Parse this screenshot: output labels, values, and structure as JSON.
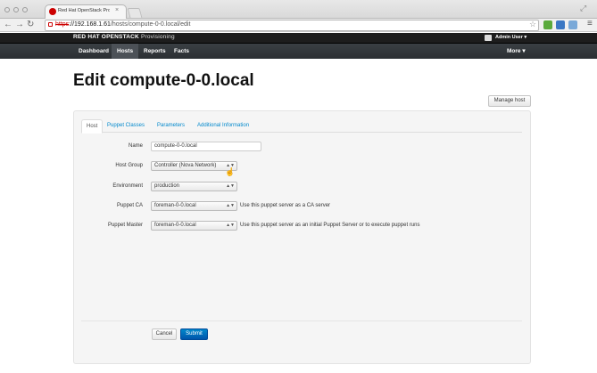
{
  "browser": {
    "tab_title": "Red Hat OpenStack Provis",
    "url_scheme": "https",
    "url_host": "://192.168.1.61",
    "url_path": "/hosts/compute-0-0.local/edit"
  },
  "header": {
    "brand": "RED HAT OPENSTACK",
    "brand_sub": "Provisioning",
    "user": "Admin User ▾"
  },
  "nav": {
    "items": [
      "Dashboard",
      "Hosts",
      "Reports",
      "Facts"
    ],
    "active": "Hosts",
    "more": "More ▾"
  },
  "page": {
    "title": "Edit compute-0-0.local",
    "manage_host": "Manage host"
  },
  "form": {
    "tabs": [
      "Host",
      "Puppet Classes",
      "Parameters",
      "Additional Information"
    ],
    "name_label": "Name",
    "name_value": "compute-0-0.local",
    "host_group_label": "Host Group",
    "host_group_value": "Controller (Nova Network)",
    "environment_label": "Environment",
    "environment_value": "production",
    "puppet_ca_label": "Puppet CA",
    "puppet_ca_value": "foreman-0-0.local",
    "puppet_ca_help": "Use this puppet server as a CA server",
    "puppet_master_label": "Puppet Master",
    "puppet_master_value": "foreman-0-0.local",
    "puppet_master_help": "Use this puppet server as an initial Puppet Server or to execute puppet runs",
    "cancel": "Cancel",
    "submit": "Submit"
  },
  "colors": {
    "link": "#0088cc",
    "primary": "#0066bb",
    "navbar": "#2b2f33"
  }
}
